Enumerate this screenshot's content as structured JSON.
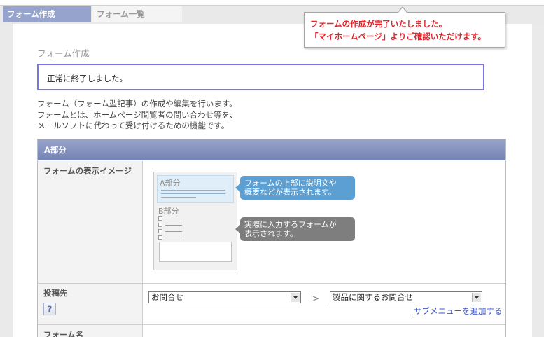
{
  "tabs": [
    {
      "label": "フォーム作成",
      "active": true
    },
    {
      "label": "フォーム一覧",
      "active": false
    }
  ],
  "toast": {
    "line1": "フォームの作成が完了いたしました。",
    "line2": "「マイホームページ」よりご確認いただけます。",
    "color": "#e0242c"
  },
  "page": {
    "section_title": "フォーム作成",
    "notice": "正常に終了しました。",
    "description": [
      "フォーム（フォーム型記事）の作成や編集を行います。",
      "フォームとは、ホームページ閲覧者の問い合わせ等を、",
      "メールソフトに代わって受け付けるための機能です。"
    ]
  },
  "form": {
    "header": "A部分",
    "rows": {
      "display_image": {
        "label": "フォームの表示イメージ",
        "preview": {
          "a_title": "A部分",
          "b_title": "B部分",
          "callout_a": [
            "フォームの上部に説明文や",
            "概要などが表示されます。"
          ],
          "callout_b": [
            "実際に入力するフォームが",
            "表示されます。"
          ]
        }
      },
      "destination": {
        "label": "投稿先",
        "help": "?",
        "select1": "お問合せ",
        "separator": ">",
        "select2": "製品に関するお問合せ",
        "add_link": "サブメニューを追加する"
      },
      "form_name": {
        "label": "フォーム名"
      }
    }
  },
  "colors": {
    "tab_active": "#95a3cd",
    "header": "#7483b4",
    "notice_border": "#7a76e0",
    "callout_blue": "#5c9fd2",
    "callout_gray": "#7e7e7e",
    "link": "#3d56c8"
  }
}
